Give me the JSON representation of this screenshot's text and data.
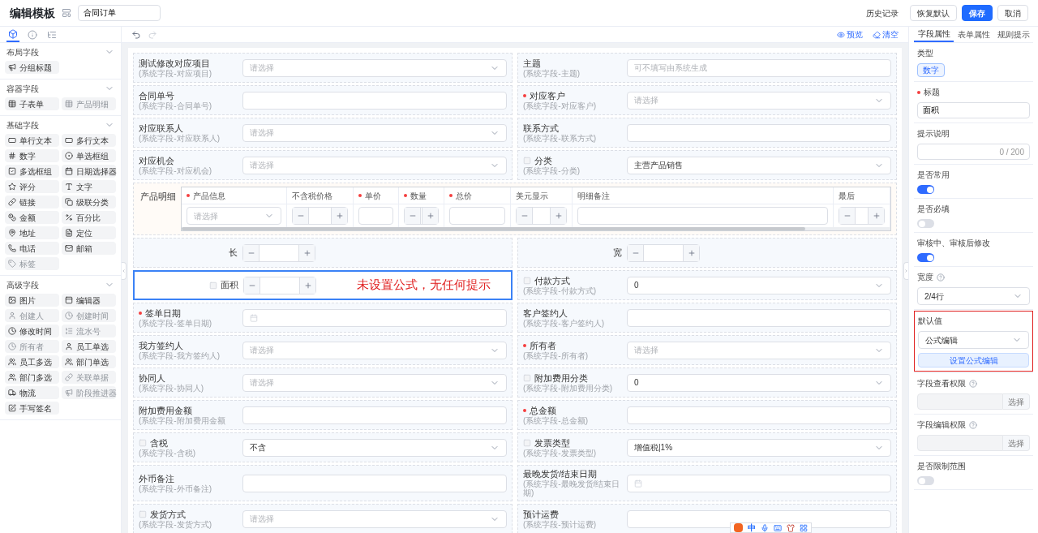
{
  "header": {
    "title": "编辑模板",
    "template_name": "合同订单",
    "actions": [
      {
        "kind": "link",
        "label": "历史记录"
      },
      {
        "kind": "default",
        "label": "恢复默认"
      },
      {
        "kind": "primary",
        "label": "保存"
      },
      {
        "kind": "default",
        "label": "取消"
      }
    ]
  },
  "sidebar": {
    "tabs": [
      {
        "selected": true
      },
      {
        "selected": false
      },
      {
        "selected": false
      }
    ],
    "sections": [
      {
        "title": "布局字段",
        "expanded": true,
        "items": [
          {
            "label": "分组标题",
            "disabled": false
          }
        ]
      },
      {
        "title": "容器字段",
        "expanded": true,
        "items": [
          {
            "label": "子表单",
            "disabled": false
          },
          {
            "label": "产品明细",
            "disabled": true
          }
        ]
      },
      {
        "title": "基础字段",
        "expanded": true,
        "items": [
          {
            "label": "单行文本",
            "disabled": false
          },
          {
            "label": "多行文本",
            "disabled": false
          },
          {
            "label": "数字",
            "disabled": false
          },
          {
            "label": "单选框组",
            "disabled": false
          },
          {
            "label": "多选框组",
            "disabled": false
          },
          {
            "label": "日期选择器",
            "disabled": false
          },
          {
            "label": "评分",
            "disabled": false
          },
          {
            "label": "文字",
            "disabled": false
          },
          {
            "label": "链接",
            "disabled": false
          },
          {
            "label": "级联分类",
            "disabled": false
          },
          {
            "label": "金额",
            "disabled": false
          },
          {
            "label": "百分比",
            "disabled": false
          },
          {
            "label": "地址",
            "disabled": false
          },
          {
            "label": "定位",
            "disabled": false
          },
          {
            "label": "电话",
            "disabled": false
          },
          {
            "label": "邮箱",
            "disabled": false
          },
          {
            "label": "标签",
            "disabled": true
          }
        ]
      },
      {
        "title": "高级字段",
        "expanded": true,
        "items": [
          {
            "label": "图片",
            "disabled": false
          },
          {
            "label": "编辑器",
            "disabled": false
          },
          {
            "label": "创建人",
            "disabled": true
          },
          {
            "label": "创建时间",
            "disabled": true
          },
          {
            "label": "修改时间",
            "disabled": false
          },
          {
            "label": "流水号",
            "disabled": true
          },
          {
            "label": "所有者",
            "disabled": true
          },
          {
            "label": "员工单选",
            "disabled": false
          },
          {
            "label": "员工多选",
            "disabled": false
          },
          {
            "label": "部门单选",
            "disabled": false
          },
          {
            "label": "部门多选",
            "disabled": false
          },
          {
            "label": "关联单据",
            "disabled": true
          },
          {
            "label": "物流",
            "disabled": false
          },
          {
            "label": "阶段推进器",
            "disabled": true
          },
          {
            "label": "手写签名",
            "disabled": false
          }
        ]
      }
    ]
  },
  "toolbar": {
    "actions": [
      {
        "kind": "preview",
        "label": "预览"
      },
      {
        "kind": "clear",
        "label": "清空"
      }
    ]
  },
  "fields": [
    {
      "kind": "select",
      "label": "测试修改对应项目",
      "sub": "(系统字段-对应项目)",
      "placeholder": "请选择",
      "required": false,
      "flagged": false,
      "selected": false
    },
    {
      "kind": "text",
      "label": "主题",
      "sub": "(系统字段-主题)",
      "placeholder": "可不填写由系统生成",
      "required": false,
      "flagged": false,
      "selected": false
    },
    {
      "kind": "text",
      "label": "合同单号",
      "sub": "(系统字段-合同单号)",
      "required": false,
      "flagged": false,
      "selected": false
    },
    {
      "kind": "select",
      "label": "对应客户",
      "sub": "(系统字段-对应客户)",
      "placeholder": "请选择",
      "required": true,
      "flagged": false,
      "selected": false
    },
    {
      "kind": "select",
      "label": "对应联系人",
      "sub": "(系统字段-对应联系人)",
      "placeholder": "请选择",
      "required": false,
      "flagged": false,
      "selected": false
    },
    {
      "kind": "text",
      "label": "联系方式",
      "sub": "(系统字段-联系方式)",
      "required": false,
      "flagged": false,
      "selected": false
    },
    {
      "kind": "select",
      "label": "对应机会",
      "sub": "(系统字段-对应机会)",
      "placeholder": "请选择",
      "required": false,
      "flagged": false,
      "selected": false
    },
    {
      "kind": "select",
      "label": "分类",
      "sub": "(系统字段-分类)",
      "value": "主营产品销售",
      "required": false,
      "flagged": true,
      "selected": false
    },
    {
      "kind": "table",
      "label": "产品明细",
      "selected": false,
      "columns": [
        {
          "title": "产品信息",
          "required": true,
          "kind": "select",
          "placeholder": "请选择"
        },
        {
          "title": "不含税价格",
          "required": false,
          "kind": "number"
        },
        {
          "title": "单价",
          "required": true,
          "kind": "text"
        },
        {
          "title": "数量",
          "required": true,
          "kind": "number"
        },
        {
          "title": "总价",
          "required": true,
          "kind": "text"
        },
        {
          "title": "美元显示",
          "required": false,
          "kind": "number"
        },
        {
          "title": "明细备注",
          "required": false,
          "kind": "text"
        },
        {
          "title": "最后",
          "required": false,
          "kind": "number"
        }
      ]
    },
    {
      "kind": "number",
      "label": "长",
      "required": false,
      "flagged": false,
      "selected": false
    },
    {
      "kind": "number",
      "label": "宽",
      "required": false,
      "flagged": false,
      "selected": false
    },
    {
      "kind": "number",
      "label": "面积",
      "note": "未设置公式，无任何提示",
      "required": false,
      "flagged": true,
      "selected": true
    },
    {
      "kind": "select",
      "label": "付款方式",
      "sub": "(系统字段-付款方式)",
      "value": "0",
      "required": false,
      "flagged": true,
      "selected": false
    },
    {
      "kind": "date",
      "label": "签单日期",
      "sub": "(系统字段-签单日期)",
      "required": true,
      "flagged": false,
      "selected": false
    },
    {
      "kind": "text",
      "label": "客户签约人",
      "sub": "(系统字段-客户签约人)",
      "required": false,
      "flagged": false,
      "selected": false
    },
    {
      "kind": "select",
      "label": "我方签约人",
      "sub": "(系统字段-我方签约人)",
      "placeholder": "请选择",
      "required": false,
      "flagged": false,
      "selected": false
    },
    {
      "kind": "select",
      "label": "所有者",
      "sub": "(系统字段-所有者)",
      "placeholder": "请选择",
      "required": true,
      "flagged": false,
      "selected": false
    },
    {
      "kind": "select",
      "label": "协同人",
      "sub": "(系统字段-协同人)",
      "placeholder": "请选择",
      "required": false,
      "flagged": false,
      "selected": false
    },
    {
      "kind": "select",
      "label": "附加费用分类",
      "sub": "(系统字段-附加费用分类)",
      "value": "0",
      "required": false,
      "flagged": true,
      "selected": false
    },
    {
      "kind": "text",
      "label": "附加费用金额",
      "sub": "(系统字段-附加费用金额",
      "required": false,
      "flagged": false,
      "selected": false
    },
    {
      "kind": "text",
      "label": "总金额",
      "sub": "(系统字段-总金额)",
      "required": true,
      "flagged": false,
      "selected": false
    },
    {
      "kind": "select",
      "label": "含税",
      "sub": "(系统字段-含税)",
      "value": "不含",
      "required": false,
      "flagged": true,
      "selected": false
    },
    {
      "kind": "select",
      "label": "发票类型",
      "sub": "(系统字段-发票类型)",
      "value": "增值税|1%",
      "required": false,
      "flagged": true,
      "selected": false
    },
    {
      "kind": "text",
      "label": "外币备注",
      "sub": "(系统字段-外币备注)",
      "required": false,
      "flagged": false,
      "selected": false
    },
    {
      "kind": "date",
      "label": "最晚发货/结束日期",
      "sub": "(系统字段-最晚发货/结束日期)",
      "required": false,
      "flagged": false,
      "selected": false
    },
    {
      "kind": "select",
      "label": "发货方式",
      "sub": "(系统字段-发货方式)",
      "placeholder": "请选择",
      "required": false,
      "flagged": true,
      "selected": false
    },
    {
      "kind": "text",
      "label": "预计运费",
      "sub": "(系统字段-预计运费)",
      "required": false,
      "flagged": false,
      "selected": false
    }
  ],
  "panel": {
    "tabs": [
      {
        "label": "字段属性",
        "selected": true
      },
      {
        "label": "表单属性",
        "selected": false
      },
      {
        "label": "规则提示",
        "selected": false
      }
    ],
    "props": [
      {
        "kind": "tag",
        "label": "类型",
        "value": "数字",
        "required": false,
        "help": false,
        "highlighted": false
      },
      {
        "kind": "input",
        "label": "标题",
        "value": "面积",
        "required": true,
        "help": false,
        "highlighted": false
      },
      {
        "kind": "textarea",
        "label": "提示说明",
        "counter": "0 / 200",
        "required": false,
        "help": false,
        "highlighted": false
      },
      {
        "kind": "switch",
        "label": "是否常用",
        "on": true,
        "required": false,
        "help": false,
        "highlighted": false
      },
      {
        "kind": "switch",
        "label": "是否必填",
        "on": false,
        "required": false,
        "help": false,
        "highlighted": false
      },
      {
        "kind": "switch",
        "label": "审核中、审核后修改",
        "on": true,
        "required": false,
        "help": false,
        "highlighted": false
      },
      {
        "kind": "select",
        "label": "宽度",
        "value": "2/4行",
        "required": false,
        "help": true,
        "highlighted": false
      },
      {
        "kind": "formula",
        "label": "默认值",
        "value": "公式编辑",
        "button": "设置公式编辑",
        "required": false,
        "help": false,
        "highlighted": true
      },
      {
        "kind": "picker",
        "label": "字段查看权限",
        "button": "选择",
        "required": false,
        "help": true,
        "highlighted": false
      },
      {
        "kind": "picker",
        "label": "字段编辑权限",
        "button": "选择",
        "required": false,
        "help": true,
        "highlighted": false
      },
      {
        "kind": "switch",
        "label": "是否限制范围",
        "on": false,
        "required": false,
        "help": false,
        "highlighted": false
      }
    ]
  },
  "ime": {
    "label": "中"
  }
}
